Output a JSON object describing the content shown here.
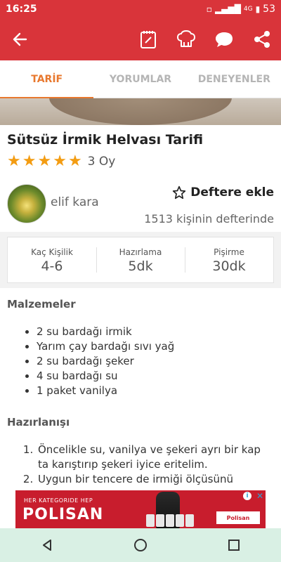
{
  "status_bar": {
    "time": "16:25",
    "network": "4G",
    "battery": "53"
  },
  "app_bar": {
    "icons": [
      "back-arrow-icon",
      "notepad-icon",
      "chef-hat-icon",
      "chat-bubble-icon",
      "share-icon"
    ]
  },
  "tabs": [
    {
      "label": "TARİF",
      "active": true
    },
    {
      "label": "YORUMLAR",
      "active": false
    },
    {
      "label": "DENEYENLER",
      "active": false
    }
  ],
  "recipe": {
    "title": "Sütsüz İrmik Helvası Tarifi",
    "stars": 5,
    "votes": "3 Oy"
  },
  "author": {
    "name": "elif kara",
    "notebook_label": "Deftere ekle",
    "notebook_count": "1513 kişinin defterinde"
  },
  "stats": [
    {
      "label": "Kaç Kişilik",
      "value": "4-6"
    },
    {
      "label": "Hazırlama",
      "value": "5dk"
    },
    {
      "label": "Pişirme",
      "value": "30dk"
    }
  ],
  "ingredients": {
    "title": "Malzemeler",
    "items": [
      "2 su bardağı irmik",
      "Yarım çay bardağı sıvı yağ",
      "2 su bardağı şeker",
      "4 su bardağı su",
      "1 paket vanilya"
    ]
  },
  "preparation": {
    "title": "Hazırlanışı",
    "steps": [
      "Öncelikle su, vanilya ve şekeri ayrı bir kap ta karıştırıp şekeri iyice eritelim.",
      "Uygun bir tencere de irmiği ölçüsünü"
    ]
  },
  "ad": {
    "small_text": "HER KATEGORIDE HEP",
    "brand": "POLISAN",
    "logo": "Polisan"
  },
  "colors": {
    "primary": "#d9343a",
    "accent": "#e8782e",
    "star": "#f39c12",
    "nav_bar": "#d9f0e4"
  }
}
